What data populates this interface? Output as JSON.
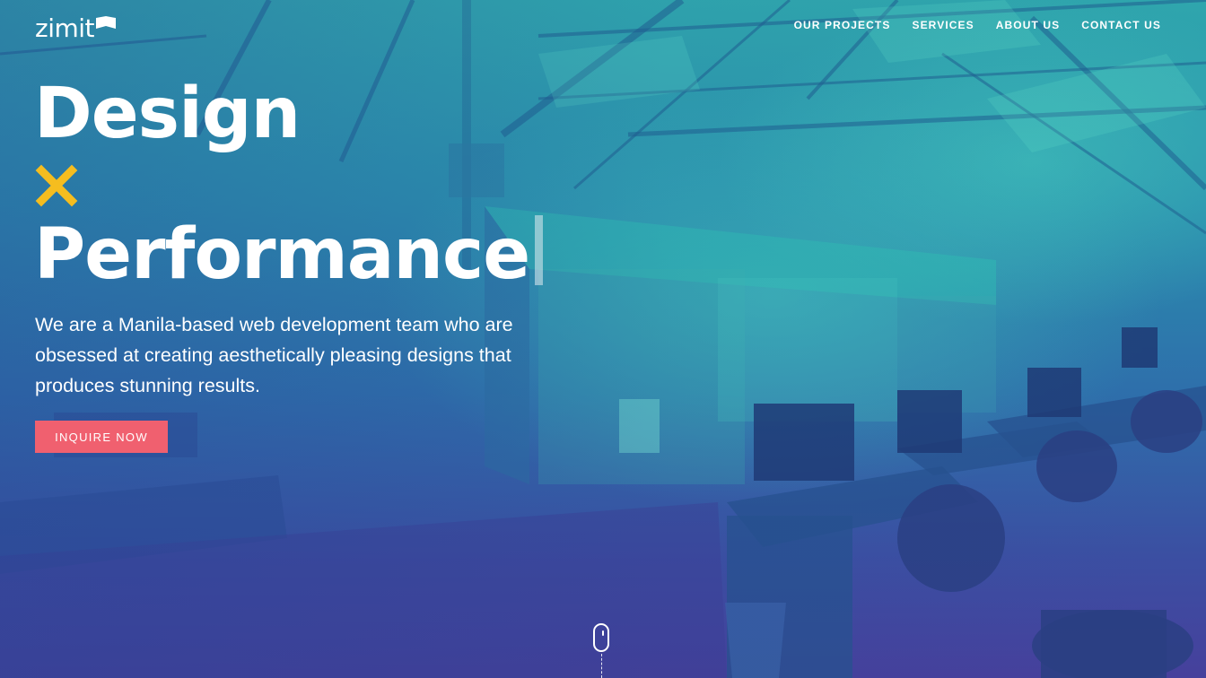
{
  "brand": {
    "logo_text": "zimit"
  },
  "nav": {
    "items": [
      {
        "label": "OUR PROJECTS"
      },
      {
        "label": "SERVICES"
      },
      {
        "label": "ABOUT US"
      },
      {
        "label": "CONTACT US"
      }
    ]
  },
  "hero": {
    "headline_line1": "Design",
    "headline_line2": "Performance",
    "description": "We are a Manila-based web development team who are obsessed at creating aesthetically pleasing designs that produces stunning results.",
    "cta_label": "INQUIRE NOW"
  },
  "colors": {
    "accent_cta": "#f0606f",
    "accent_x": "#f5bd1f",
    "overlay_teal": "#2fa6ad",
    "overlay_purple": "#46409c"
  },
  "icons": {
    "logo_mark": "flag-icon",
    "separator": "x-icon",
    "scroll": "mouse-scroll-icon"
  }
}
